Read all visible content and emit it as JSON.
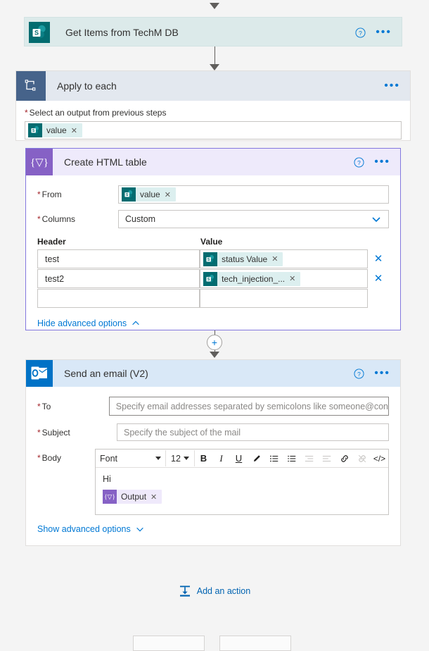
{
  "flow": {
    "get_items": {
      "title": "Get Items from TechM DB",
      "icon": "sharepoint-icon"
    },
    "apply_to_each": {
      "title": "Apply to each",
      "icon": "loop-icon",
      "output_field": {
        "label": "Select an output from previous steps",
        "required": true,
        "token": {
          "text": "value",
          "icon": "sharepoint-icon"
        }
      }
    },
    "create_html_table": {
      "title": "Create HTML table",
      "icon": "expression-icon",
      "help_icon": "help-circle-icon",
      "more_icon": "ellipsis-icon",
      "from": {
        "label": "From",
        "required": true,
        "token": {
          "text": "value",
          "icon": "sharepoint-icon"
        }
      },
      "columns": {
        "label": "Columns",
        "required": true,
        "value": "Custom",
        "chevron": "chevron-down-icon"
      },
      "table": {
        "header_col": "Header",
        "value_col": "Value",
        "rows": [
          {
            "header": "test",
            "value_token": "status Value",
            "token_icon": "sharepoint-icon",
            "has_delete": true
          },
          {
            "header": "test2",
            "value_token": "tech_injection_...",
            "token_icon": "sharepoint-icon",
            "has_delete": true
          },
          {
            "header": "",
            "value_token": "",
            "token_icon": "",
            "has_delete": false
          }
        ]
      },
      "advanced_link": {
        "label": "Hide advanced options",
        "chevron": "chevron-up-icon"
      }
    },
    "add_between": {
      "icon": "plus-icon"
    },
    "send_email": {
      "title": "Send an email (V2)",
      "icon": "outlook-icon",
      "help_icon": "help-circle-icon",
      "more_icon": "ellipsis-icon",
      "to": {
        "label": "To",
        "required": true,
        "value": "",
        "placeholder": "Specify email addresses separated by semicolons like someone@con"
      },
      "subject": {
        "label": "Subject",
        "required": true,
        "value": "",
        "placeholder": "Specify the subject of the mail"
      },
      "body": {
        "label": "Body",
        "required": true,
        "toolbar": {
          "font_name": "Font",
          "font_size": "12",
          "bold": "B",
          "italic": "I",
          "underline": "U",
          "text_color": "pen-icon",
          "numbered_list": "numbered-list-icon",
          "bulleted_list": "bulleted-list-icon",
          "outdent": "outdent-icon",
          "indent": "indent-icon",
          "link": "link-icon",
          "unlink": "unlink-icon",
          "code_view": "</>"
        },
        "content_text": "Hi",
        "content_token": {
          "text": "Output",
          "icon": "expression-icon"
        }
      },
      "advanced_link": {
        "label": "Show advanced options",
        "chevron": "chevron-down-icon"
      }
    },
    "add_action": {
      "label": "Add an action",
      "icon": "add-action-icon"
    }
  },
  "colors": {
    "sharepoint": "#036c70",
    "outlook": "#0072c6",
    "expression_purple": "#8661c5",
    "loop_blue": "#46638a",
    "accent_link": "#0078d4",
    "required_red": "#a4262c",
    "card_teal": "#dceaea",
    "card_applyhead": "#e3e8ef",
    "card_lavender": "#eeeafb",
    "card_emailhead": "#d9e8f7"
  }
}
